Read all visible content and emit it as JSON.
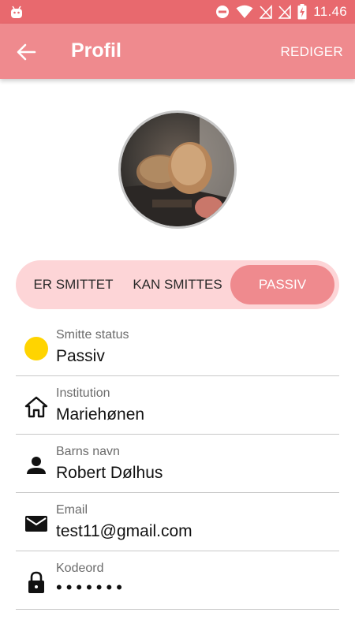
{
  "status_bar": {
    "time": "11.46",
    "icons": [
      "android-icon",
      "do-not-disturb-icon",
      "wifi-icon",
      "no-signal-icon",
      "no-signal-icon",
      "battery-charging-icon"
    ]
  },
  "app_bar": {
    "back_icon": "arrow-left-icon",
    "title": "Profil",
    "edit_label": "REDIGER"
  },
  "profile": {
    "avatar_icon": "profile-photo"
  },
  "status_selector": {
    "options": [
      "ER SMITTET",
      "KAN SMITTES",
      "PASSIV"
    ],
    "selected": "PASSIV"
  },
  "fields": [
    {
      "label": "Smitte status",
      "value": "Passiv",
      "icon": "status-dot-icon",
      "color": "#ffd400"
    },
    {
      "label": "Institution",
      "value": "Mariehønen",
      "icon": "home-icon"
    },
    {
      "label": "Barns navn",
      "value": "Robert Dølhus",
      "icon": "person-icon"
    },
    {
      "label": "Email",
      "value": "test11@gmail.com",
      "icon": "mail-icon"
    },
    {
      "label": "Kodeord",
      "value": "•••••••",
      "icon": "lock-icon"
    }
  ],
  "colors": {
    "status_bar": "#e8696e",
    "app_bar": "#ef8a8e",
    "segment_bg": "#fdd5d7",
    "segment_selected": "#ef8a8e",
    "status_dot": "#ffd400"
  }
}
